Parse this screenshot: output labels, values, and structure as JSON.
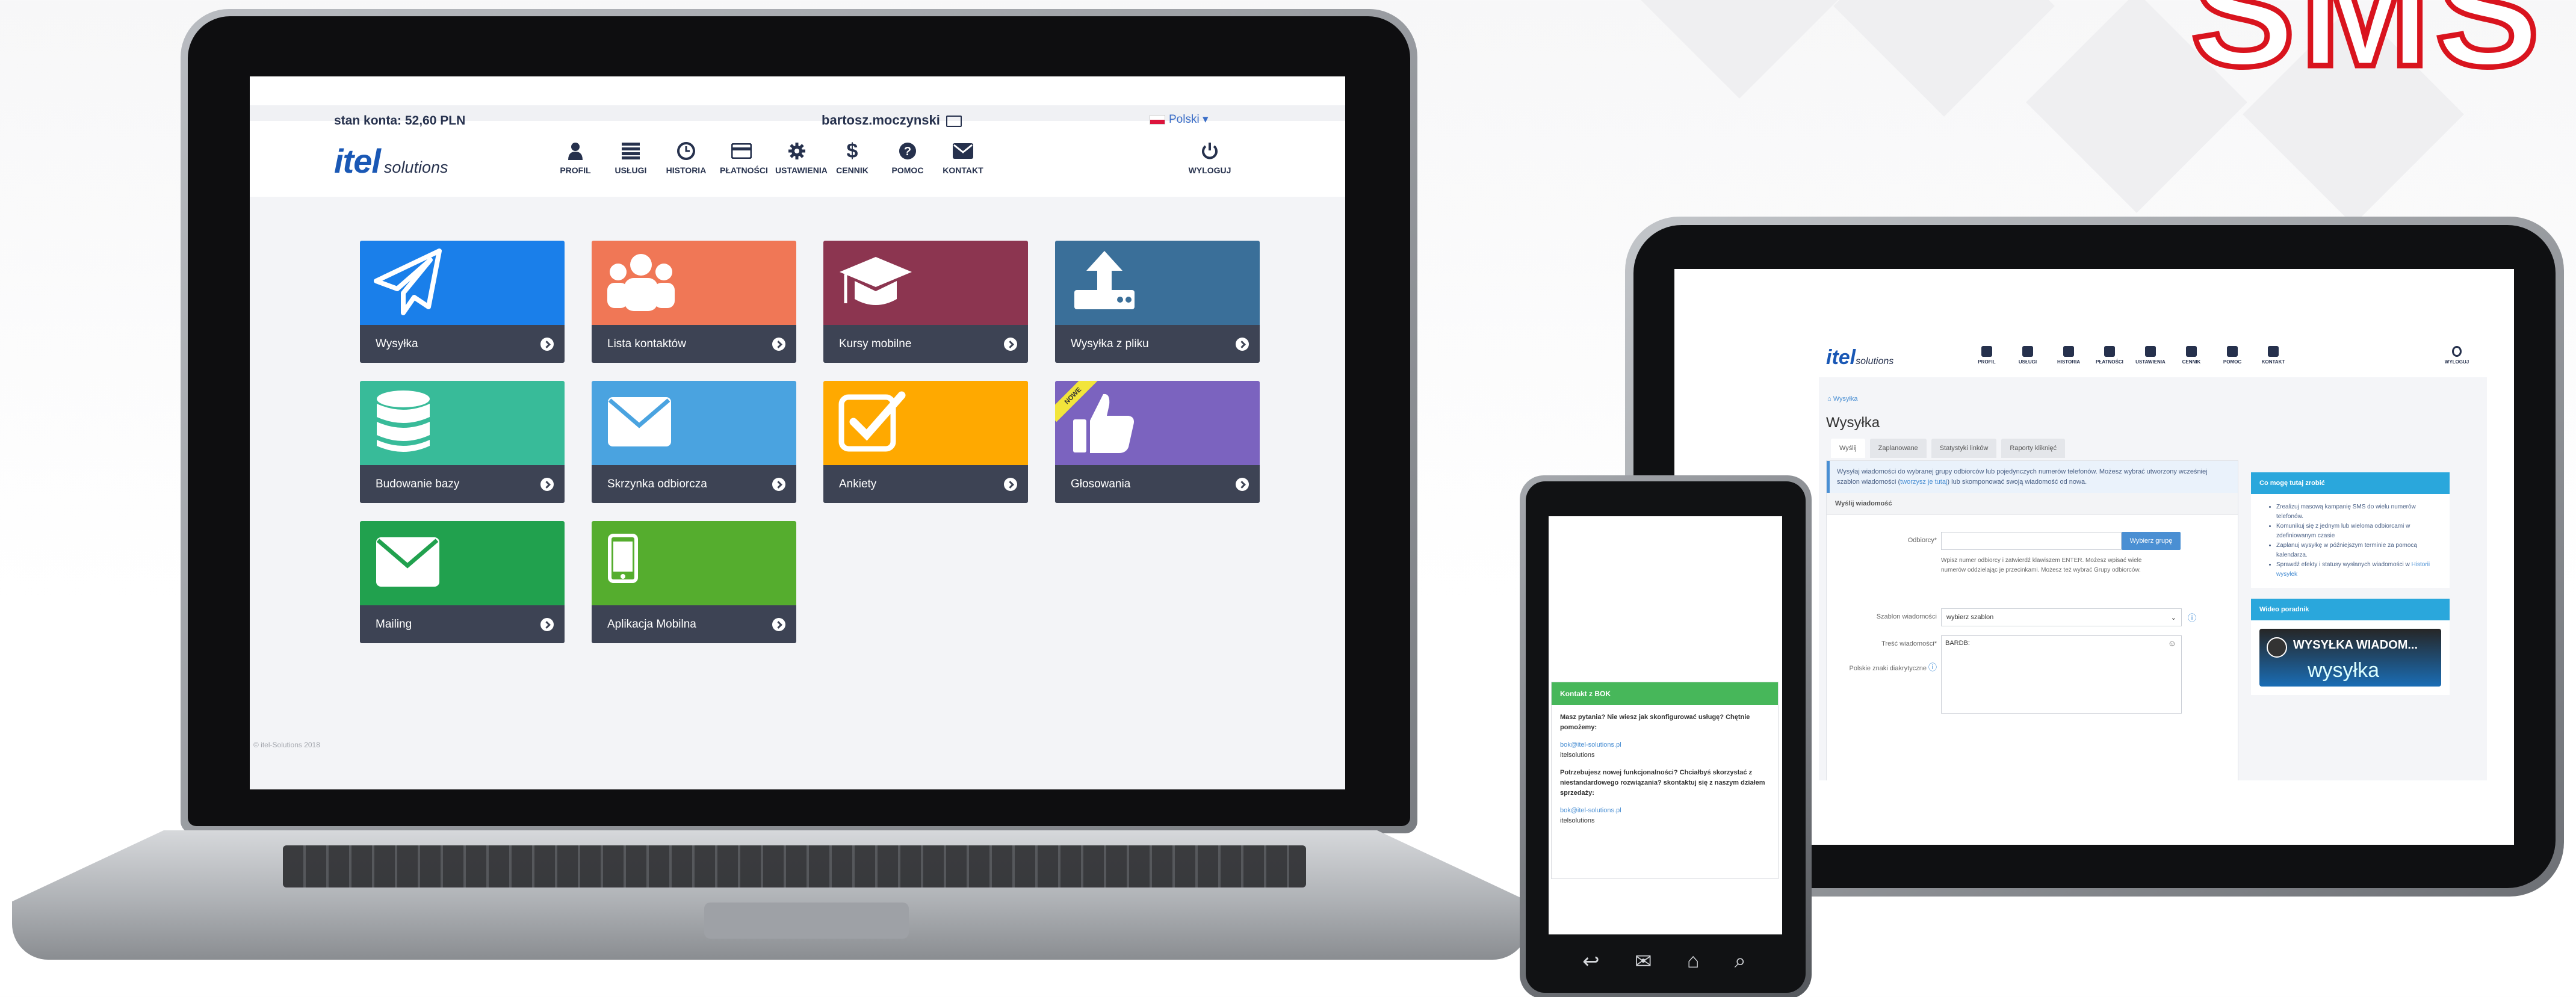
{
  "brand": {
    "sms_logo": "SMS",
    "accent": "#d9141e"
  },
  "laptop": {
    "balance": "stan konta: 52,60 PLN",
    "username": "bartosz.moczynski",
    "language": "Polski",
    "logo_main": "itel",
    "logo_sub": "solutions",
    "nav": [
      {
        "label": "PROFIL",
        "icon": "user-icon"
      },
      {
        "label": "USŁUGI",
        "icon": "list-icon"
      },
      {
        "label": "HISTORIA",
        "icon": "clock-icon"
      },
      {
        "label": "PŁATNOŚCI",
        "icon": "card-icon"
      },
      {
        "label": "USTAWIENIA",
        "icon": "gear-icon"
      },
      {
        "label": "CENNIK",
        "icon": "dollar-icon"
      },
      {
        "label": "POMOC",
        "icon": "question-icon"
      },
      {
        "label": "KONTAKT",
        "icon": "envelope-icon"
      }
    ],
    "logout": "WYLOGUJ",
    "tiles": [
      {
        "label": "Wysyłka",
        "color": "#1a7fea",
        "icon": "paper-plane-icon"
      },
      {
        "label": "Lista kontaktów",
        "color": "#f07756",
        "icon": "users-icon"
      },
      {
        "label": "Kursy mobilne",
        "color": "#8c3550",
        "icon": "graduation-cap-icon"
      },
      {
        "label": "Wysyłka z pliku",
        "color": "#3a6f99",
        "icon": "upload-icon"
      },
      {
        "label": "Budowanie bazy",
        "color": "#38bb99",
        "icon": "database-icon"
      },
      {
        "label": "Skrzynka odbiorcza",
        "color": "#4aa3e0",
        "icon": "envelope-icon"
      },
      {
        "label": "Ankiety",
        "color": "#ffa900",
        "icon": "checkbox-icon"
      },
      {
        "label": "Głosowania",
        "color": "#7b63bf",
        "icon": "thumbs-up-icon",
        "badge": "NOWE"
      },
      {
        "label": "Mailing",
        "color": "#21a14e",
        "icon": "envelope-icon"
      },
      {
        "label": "Aplikacja Mobilna",
        "color": "#55ad2e",
        "icon": "mobile-icon"
      }
    ],
    "copyright": "© itel-Solutions 2018"
  },
  "tablet": {
    "breadcrumb": "⌂  Wysyłka",
    "title": "Wysyłka",
    "tabs": [
      "Wyślij",
      "Zaplanowane",
      "Statystyki linków",
      "Raporty kliknięć"
    ],
    "info_text": "Wysyłaj wiadomości do wybranej grupy odbiorców lub pojedynczych numerów telefonów. Możesz wybrać utworzony wcześniej szablon wiadomości (",
    "info_link": "tworzysz je tutaj",
    "info_text_end": ") lub skomponować swoją wiadomość od nowa.",
    "section": "Wyślij wiadomość",
    "recipients_label": "Odbiorcy*",
    "choose_group": "Wybierz grupę",
    "recipients_help": "Wpisz numer odbiorcy i zatwierdź klawiszem ENTER. Możesz wpisać wiele numerów oddzielając je przecinkami. Możesz też wybrać Grupy odbiorców.",
    "template_label": "Szablon wiadomości",
    "template_value": "wybierz szablon",
    "content_label": "Treść wiadomości*",
    "content_value": "BARDB:",
    "polish_label": "Polskie znaki diakrytyczne",
    "side_title": "Co mogę tutaj zrobić",
    "side_items": [
      "Zrealizuj masową kampanię SMS do wielu numerów telefonów.",
      "Komunikuj się z jednym lub wieloma odbiorcami w zdefiniowanym czasie",
      "Zaplanuj wysyłkę w późniejszym terminie za pomocą kalendarza.",
      "Sprawdź efekty i statusy wysłanych wiadomości w "
    ],
    "side_link": "Historii wysyłek",
    "video_title": "Wideo poradnik",
    "video_caption": "WYSYŁKA WIADOM...",
    "video_sub": "wysyłka"
  },
  "phone": {
    "card_title": "Kontakt z BOK",
    "q1": "Masz pytania? Nie wiesz jak skonfigurować usługę? Chętnie pomożemy:",
    "email1": "bok@itel-solutions.pl",
    "company1": "itelsolutions",
    "q2": "Potrzebujesz nowej funkcjonalności? Chciałbyś skorzystać z niestandardowego rozwiązania? skontaktuj się z naszym działem sprzedaży:",
    "email2": "bok@itel-solutions.pl",
    "company2": "itelsolutions"
  }
}
